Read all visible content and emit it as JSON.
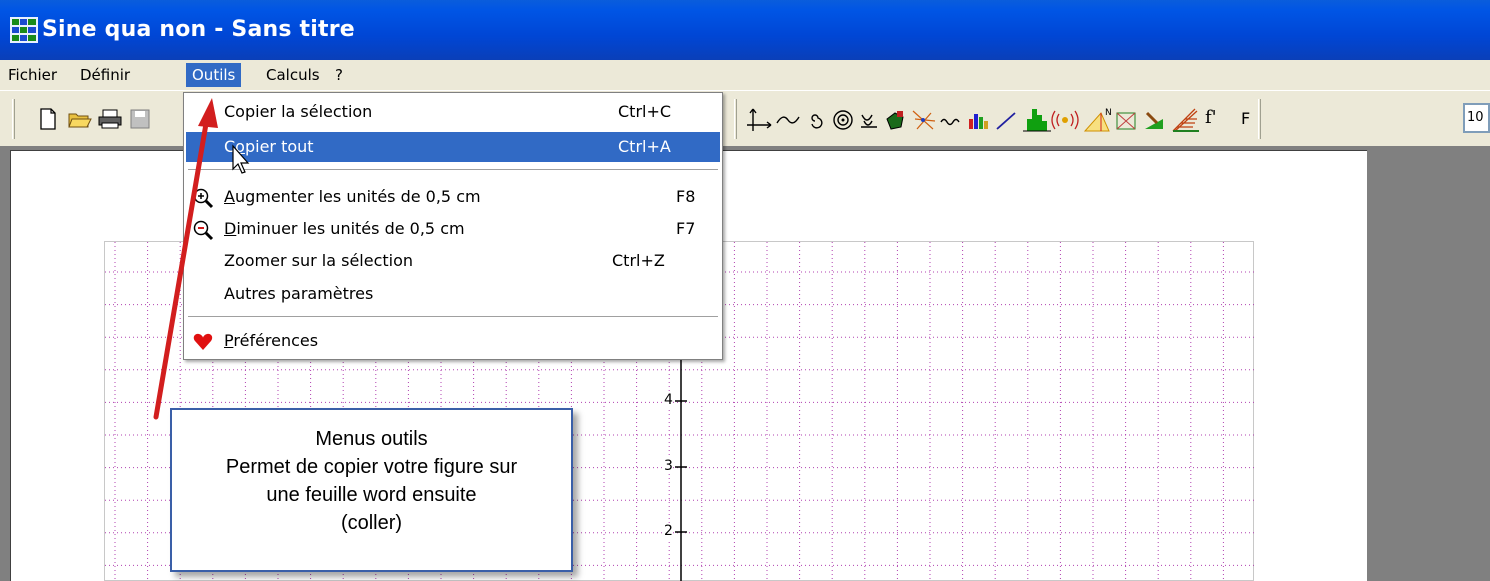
{
  "window": {
    "title": "Sine qua non - Sans titre"
  },
  "menubar": {
    "items": [
      "Fichier",
      "Définir",
      "Outils",
      "Calculs",
      "?"
    ],
    "active": "Outils"
  },
  "toolbar": {
    "left_icons": [
      "new-file-icon",
      "open-folder-icon",
      "print-icon",
      "save-icon"
    ],
    "right_icons": [
      "axes-icon",
      "curve-icon",
      "spiral-small-icon",
      "spiral-icon",
      "sequence-icon",
      "region-icon",
      "scatter-icon",
      "wave-icon",
      "bar-chart-icon",
      "line-icon",
      "histogram-icon",
      "sound-icon",
      "triangle-icon",
      "cross-icon",
      "tool-icon",
      "ladder-icon"
    ],
    "f_prime": "f'",
    "f_label": "F",
    "zoom_value": "10"
  },
  "outils_menu": {
    "items": [
      {
        "label": "Copier la sélection",
        "shortcut": "Ctrl+C",
        "icon": ""
      },
      {
        "label": "Copier tout",
        "shortcut": "Ctrl+A",
        "icon": "",
        "highlighted": true
      },
      {
        "label": "Augmenter les unités de 0,5 cm",
        "shortcut": "F8",
        "icon": "zoom-in-icon"
      },
      {
        "label": "Diminuer les unités de 0,5 cm",
        "shortcut": "F7",
        "icon": "zoom-out-icon"
      },
      {
        "label": "Zoomer sur la sélection",
        "shortcut": "Ctrl+Z",
        "icon": ""
      },
      {
        "label": "Autres paramètres",
        "shortcut": "",
        "icon": ""
      },
      {
        "label": "Préférences",
        "shortcut": "",
        "icon": "heart-icon"
      }
    ]
  },
  "graph": {
    "y_ticks": [
      "4",
      "3",
      "2"
    ]
  },
  "callout": {
    "lines": [
      "Menus outils",
      "Permet de copier votre figure sur",
      "une feuille word ensuite",
      "(coller)"
    ]
  },
  "colors": {
    "titlebar": "#0055e5",
    "highlight": "#316ac5",
    "grid_dots": "#b040b0",
    "arrow": "#d21e1e",
    "heart": "#e01010"
  }
}
